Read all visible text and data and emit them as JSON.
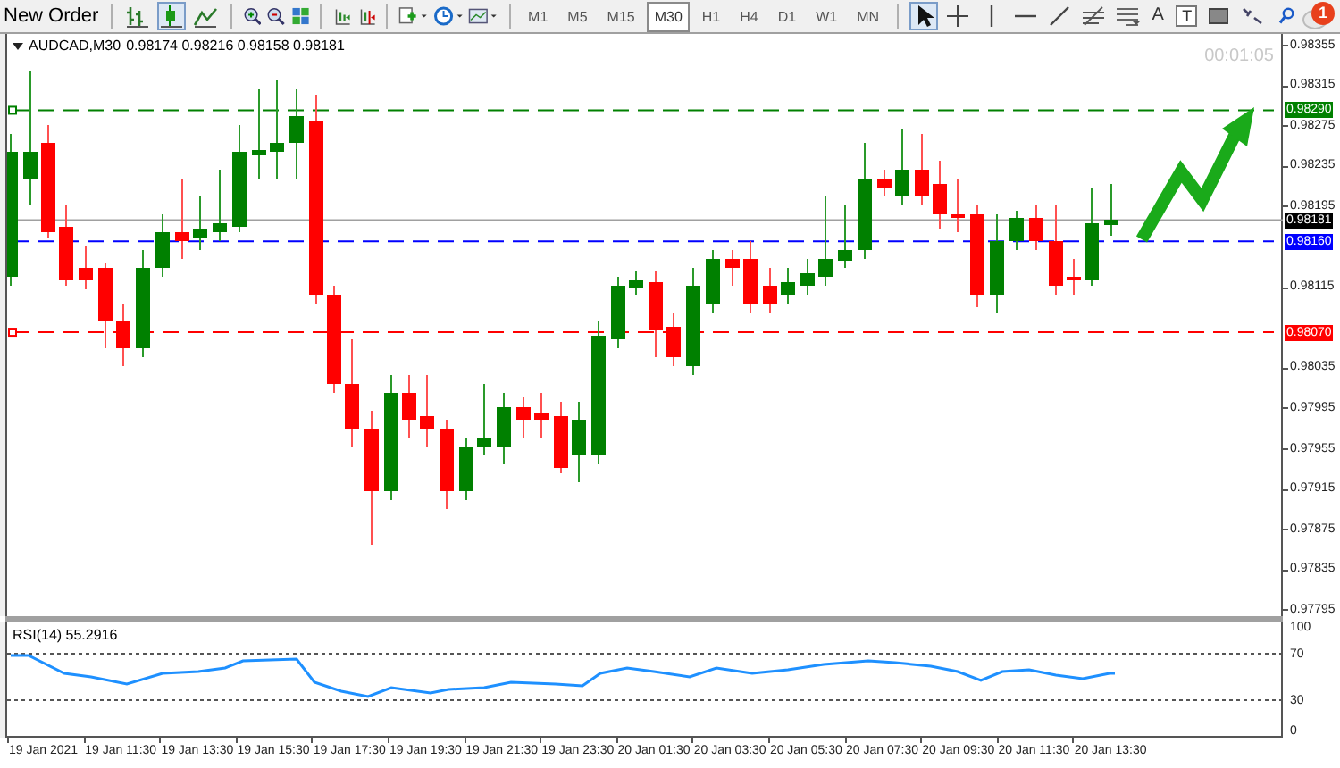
{
  "toolbar": {
    "new_order": "New Order",
    "chart_modes": [
      {
        "kind": "bars",
        "selected": false
      },
      {
        "kind": "candles",
        "selected": true
      },
      {
        "kind": "line",
        "selected": false
      }
    ],
    "timeframes": [
      {
        "label": "M1",
        "selected": false
      },
      {
        "label": "M5",
        "selected": false
      },
      {
        "label": "M15",
        "selected": false
      },
      {
        "label": "M30",
        "selected": true
      },
      {
        "label": "H1",
        "selected": false
      },
      {
        "label": "H4",
        "selected": false
      },
      {
        "label": "D1",
        "selected": false
      },
      {
        "label": "W1",
        "selected": false
      },
      {
        "label": "MN",
        "selected": false
      }
    ],
    "tools": [
      {
        "kind": "cursor",
        "selected": true
      },
      {
        "kind": "crosshair",
        "selected": false
      },
      {
        "kind": "vline",
        "selected": false
      },
      {
        "kind": "hline",
        "selected": false
      },
      {
        "kind": "trendline",
        "selected": false
      },
      {
        "kind": "fibo",
        "selected": false
      },
      {
        "kind": "channel",
        "selected": false
      },
      {
        "kind": "text",
        "label": "A",
        "selected": false
      },
      {
        "kind": "label",
        "label": "T",
        "selected": false
      },
      {
        "kind": "rectangle",
        "selected": false
      },
      {
        "kind": "shapes",
        "selected": false
      }
    ],
    "notification_count": "1"
  },
  "chart": {
    "symbol": "AUDCAD,M30",
    "ohlc": "0.98174 0.98216 0.98158 0.98181",
    "countdown": "00:01:05",
    "price_levels": [
      {
        "price": "0.98290",
        "color": "#008000",
        "kind": "dashed"
      },
      {
        "price": "0.98181",
        "color": "#000000",
        "kind": "current"
      },
      {
        "price": "0.98160",
        "color": "#0000ff",
        "kind": "dashed"
      },
      {
        "price": "0.98070",
        "color": "#ff0000",
        "kind": "dashed"
      }
    ],
    "price_axis": [
      "0.98355",
      "0.98315",
      "0.98275",
      "0.98235",
      "0.98195",
      "0.98115",
      "0.98035",
      "0.97995",
      "0.97955",
      "0.97915",
      "0.97875",
      "0.97835",
      "0.97795"
    ]
  },
  "rsi": {
    "title": "RSI(14) 55.2916",
    "axis": [
      "100",
      "70",
      "30",
      "0"
    ]
  },
  "time_axis": [
    "19 Jan 2021",
    "19 Jan 11:30",
    "19 Jan 13:30",
    "19 Jan 15:30",
    "19 Jan 17:30",
    "19 Jan 19:30",
    "19 Jan 21:30",
    "19 Jan 23:30",
    "20 Jan 01:30",
    "20 Jan 03:30",
    "20 Jan 05:30",
    "20 Jan 07:30",
    "20 Jan 09:30",
    "20 Jan 11:30",
    "20 Jan 13:30"
  ]
}
